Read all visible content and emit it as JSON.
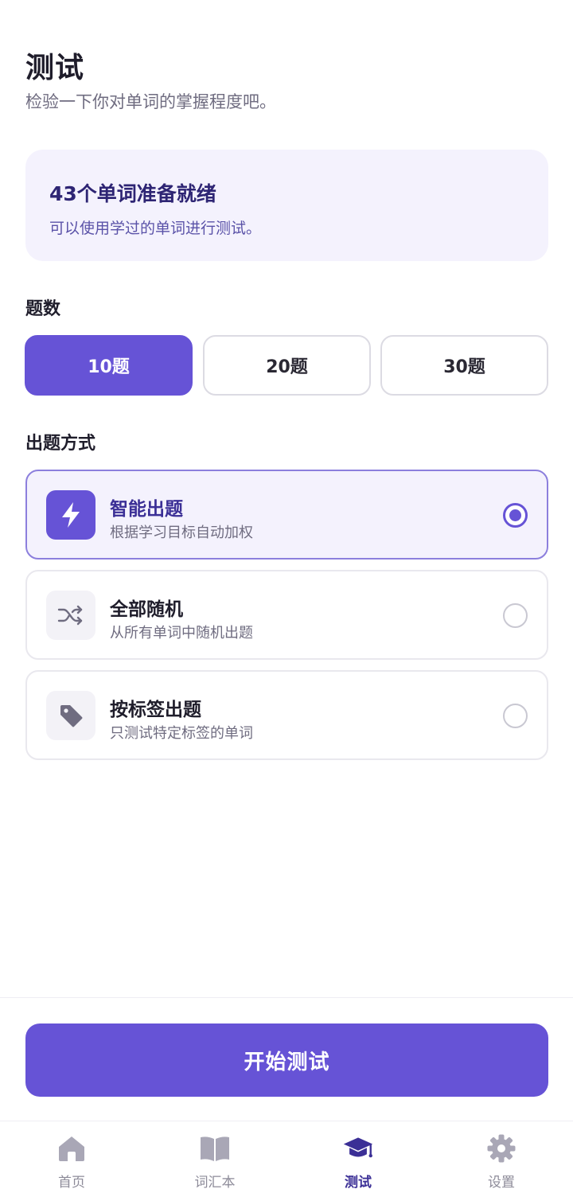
{
  "header": {
    "title": "测试",
    "subtitle": "检验一下你对单词的掌握程度吧。"
  },
  "ready_card": {
    "title": "43个单词准备就绪",
    "description": "可以使用学过的单词进行测试。"
  },
  "question_count": {
    "label": "题数",
    "options": [
      "10题",
      "20题",
      "30题"
    ],
    "selected": "10题"
  },
  "mode": {
    "label": "出题方式",
    "options": [
      {
        "title": "智能出题",
        "description": "根据学习目标自动加权",
        "icon": "lightning-icon",
        "selected": true
      },
      {
        "title": "全部随机",
        "description": "从所有单词中随机出题",
        "icon": "shuffle-icon",
        "selected": false
      },
      {
        "title": "按标签出题",
        "description": "只测试特定标签的单词",
        "icon": "tag-icon",
        "selected": false
      }
    ]
  },
  "start_button": {
    "label": "开始测试"
  },
  "nav": {
    "items": [
      {
        "label": "首页",
        "icon": "home-icon",
        "active": false
      },
      {
        "label": "词汇本",
        "icon": "book-icon",
        "active": false
      },
      {
        "label": "测试",
        "icon": "graduation-cap-icon",
        "active": true
      },
      {
        "label": "设置",
        "icon": "gear-icon",
        "active": false
      }
    ]
  },
  "colors": {
    "accent": "#6653d6",
    "accent_light": "#f4f2fd",
    "text_dark": "#1f1d2b",
    "text_muted": "#6f6c80",
    "nav_inactive": "#a9a7b6"
  }
}
